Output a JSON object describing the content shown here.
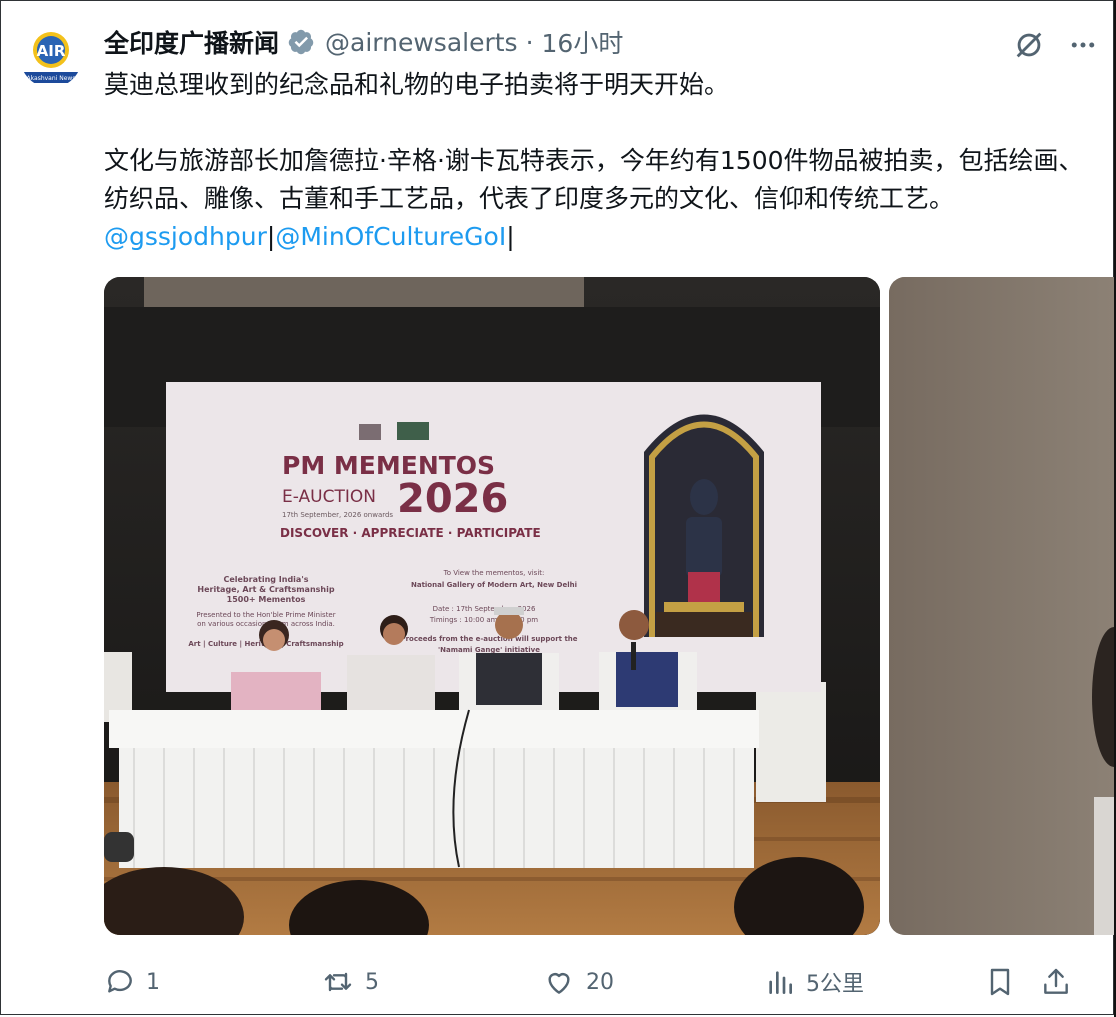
{
  "account": {
    "display_name": "全印度广播新闻",
    "handle": "@airnewsalerts",
    "separator": "·",
    "timestamp": "16小时",
    "avatar_label": "Akashvani News",
    "verified": true
  },
  "tweet": {
    "line1": "莫迪总理收到的纪念品和礼物的电子拍卖将于明天开始。",
    "body": "文化与旅游部长加詹德拉·辛格·谢卡瓦特表示，今年约有1500件物品被拍卖，包括绘画、纺织品、雕像、古董和手工艺品，代表了印度多元的文化、信仰和传统工艺。",
    "mention1": "@gssjodhpur",
    "sep1": "|",
    "mention2": "@MinOfCultureGoI",
    "sep2": "|"
  },
  "banner": {
    "title": "PM MEMENTOS",
    "subtitle": "E-AUCTION",
    "year": "2026",
    "dates": "17th September, 2026 onwards",
    "tagline": "DISCOVER · APPRECIATE · PARTICIPATE",
    "left_block": [
      "Celebrating India's",
      "Heritage, Art & Craftsmanship",
      "1500+ Mementos",
      "Presented to the Hon'ble Prime Minister",
      "on various occasions from across India.",
      "Art | Culture | Heritage | Craftsmanship"
    ],
    "mid_block": [
      "To View the mementos, visit:",
      "National Gallery of Modern Art, New Delhi",
      "Date : 17th September, 2026",
      "Timings : 10:00 am - 06:00 pm",
      "Proceeds from the e-auction will support the",
      "'Namami Gange' initiative"
    ]
  },
  "actions": {
    "replies": "1",
    "reposts": "5",
    "likes": "20",
    "views": "5公里"
  },
  "icons": [
    "verified-badge-icon",
    "grok-icon",
    "more-icon",
    "reply-icon",
    "repost-icon",
    "like-icon",
    "views-icon",
    "bookmark-icon",
    "share-icon"
  ],
  "colors": {
    "link": "#1d9bf0",
    "muted": "#536471",
    "text": "#0f1419"
  }
}
